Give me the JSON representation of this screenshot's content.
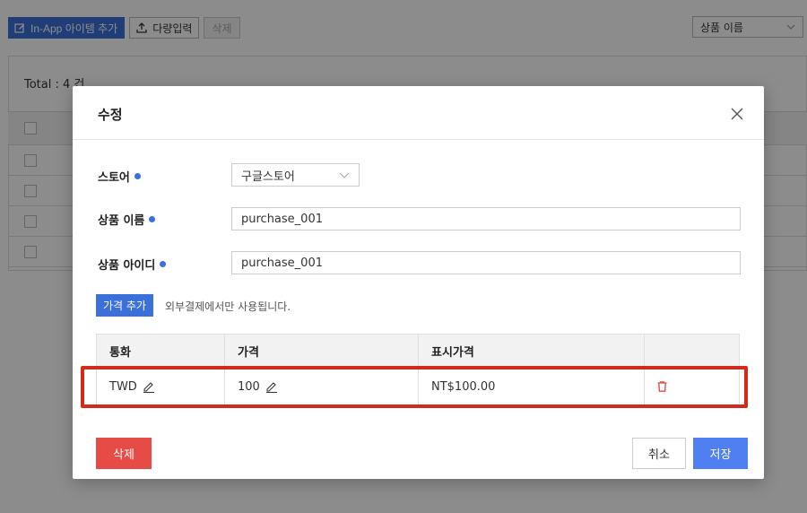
{
  "background": {
    "toolbar": {
      "add_inapp_label": "In-App 아이템 추가",
      "bulk_input_label": "다량입력",
      "delete_label": "삭제"
    },
    "sort_select": "상품 이름",
    "total_label": "Total : 4 건"
  },
  "modal": {
    "title": "수정",
    "fields": {
      "store_label": "스토어",
      "store_value": "구글스토어",
      "product_name_label": "상품 이름",
      "product_name_value": "purchase_001",
      "product_id_label": "상품 아이디",
      "product_id_value": "purchase_001"
    },
    "add_price_label": "가격 추가",
    "helper_text": "외부결제에서만 사용됩니다.",
    "price_table": {
      "headers": [
        "통화",
        "가격",
        "표시가격",
        ""
      ],
      "rows": [
        {
          "currency": "TWD",
          "price": "100",
          "display_price": "NT$100.00"
        }
      ]
    },
    "delete_label": "삭제",
    "cancel_label": "취소",
    "save_label": "저장"
  },
  "colors": {
    "primary": "#3b6fd9",
    "save": "#4f7ff0",
    "danger": "#e64b46",
    "highlight": "#d22b1e"
  }
}
